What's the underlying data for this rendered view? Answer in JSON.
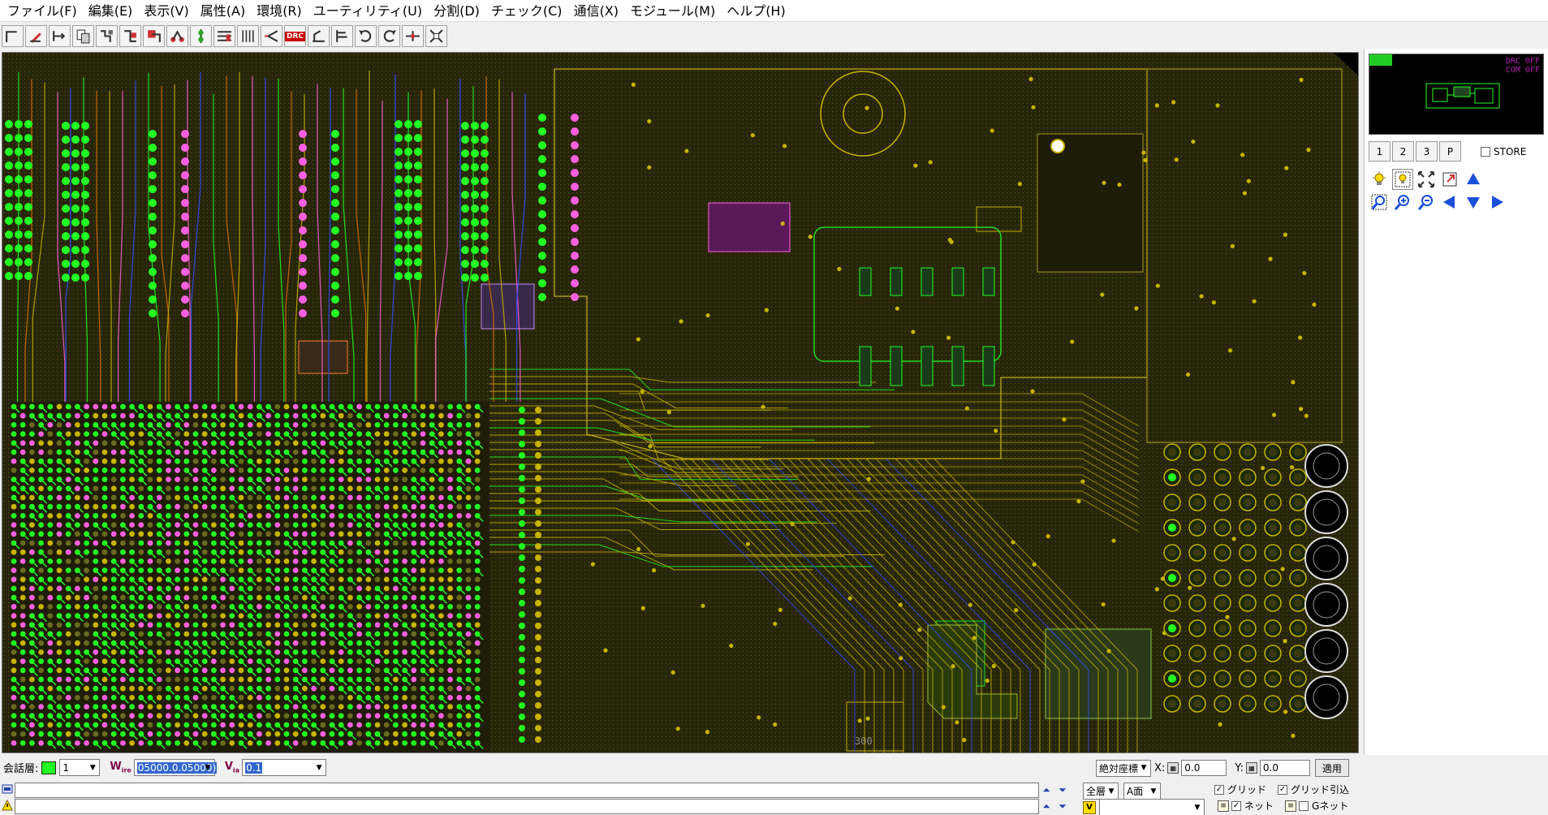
{
  "menubar": {
    "items": [
      "ファイル(F)",
      "編集(E)",
      "表示(V)",
      "属性(A)",
      "環境(R)",
      "ユーティリティ(U)",
      "分割(D)",
      "チェック(C)",
      "通信(X)",
      "モジュール(M)",
      "ヘルプ(H)"
    ]
  },
  "toolbar": {
    "drc_label": "DRC",
    "tools": [
      "wire-tool",
      "edit-tool",
      "move-tool",
      "copy-tool",
      "layer-tool",
      "parts-tool",
      "via-tool",
      "net-tool",
      "stack-tool",
      "align-tool",
      "bus-tool",
      "route-tool",
      "drc-tool",
      "measure-tool",
      "push-tool",
      "undo-tool",
      "redo-tool",
      "split-tool",
      "fit-tool"
    ]
  },
  "canvas": {
    "board_label": "300",
    "colors": {
      "background": "#000000",
      "trace_yellow": "#c8b400",
      "trace_green": "#22ff22",
      "trace_pink": "#ff60e0",
      "trace_orange": "#e07000",
      "trace_blue": "#3050ff"
    }
  },
  "minimap": {
    "status_line1": "DRC OFF",
    "status_line2": "COM OFF"
  },
  "view_buttons": {
    "buttons": [
      "1",
      "2",
      "3",
      "P"
    ],
    "store_label": "STORE"
  },
  "bottom": {
    "layer_label": "会話層:",
    "layer_value": "1",
    "wire_label": "W",
    "wire_sub": "ire",
    "wire_value": "05000.0.05000)",
    "via_label": "V",
    "via_sub": "ia",
    "via_value": "0.1",
    "coord_mode": "絶対座標",
    "x_label": "X:",
    "x_value": "0.0",
    "y_label": "Y:",
    "y_value": "0.0",
    "apply_label": "適用",
    "all_layers": "全層",
    "side": "A面",
    "grid_label": "グリッド",
    "grid_snap_label": "グリッド引込",
    "net_label": "ネット",
    "gnet_label": "Gネット",
    "v_prefix": "V"
  }
}
